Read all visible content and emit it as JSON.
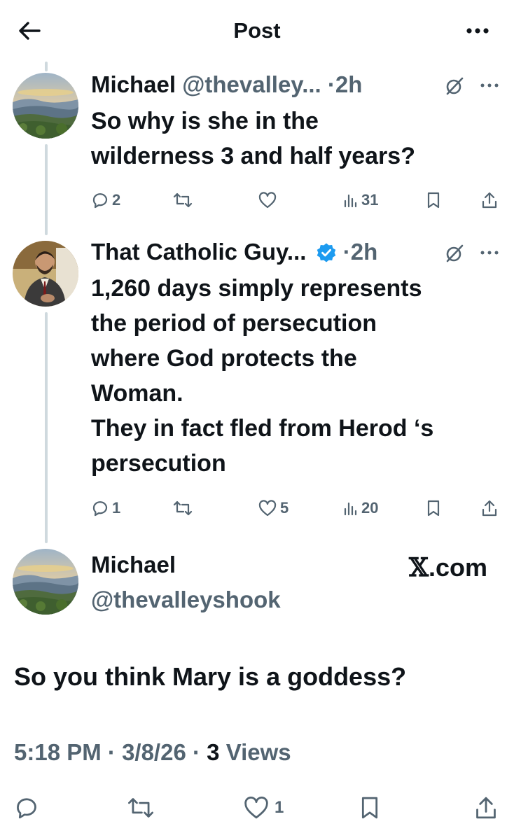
{
  "header": {
    "title": "Post",
    "back_icon": "arrow-left-icon",
    "more_icon": "more-horizontal-icon"
  },
  "colors": {
    "text": "#0f1419",
    "secondary": "#536471",
    "thread_line": "#cfd9de",
    "verified": "#1d9bf0"
  },
  "replies": [
    {
      "name": "Michael",
      "handle": "@thevalley...",
      "dot": "·",
      "time": "2h",
      "text_lines": [
        "So why is she in the",
        "wilderness 3 and half years?"
      ],
      "stats": {
        "replies": "2",
        "reposts": "",
        "likes": "",
        "views": "31"
      }
    },
    {
      "name": "That Catholic Guy...",
      "verified": true,
      "dot": "·",
      "time": "2h",
      "text_lines": [
        "1,260 days simply represents",
        "the period of persecution",
        "where God protects the",
        "Woman.",
        "They in fact fled from Herod ‘s",
        "persecution"
      ],
      "stats": {
        "replies": "1",
        "reposts": "",
        "likes": "5",
        "views": "20"
      }
    }
  ],
  "main_post": {
    "name": "Michael",
    "handle": "@thevalleyshook",
    "source_mark": "𝕏",
    "source_rest": ".com",
    "text": "So you think Mary is a goddess?",
    "time": "5:18 PM",
    "sep": "·",
    "date": "3/8/26",
    "views_count": "3",
    "views_label": "Views",
    "likes": "1"
  }
}
